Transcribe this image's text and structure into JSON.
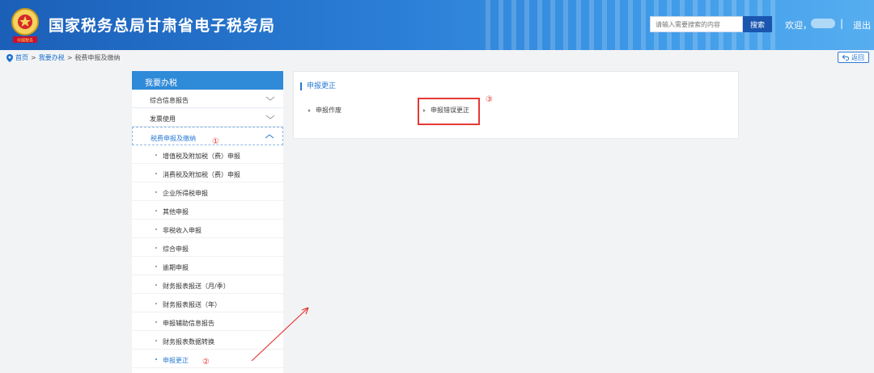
{
  "header": {
    "site_title": "国家税务总局甘肃省电子税务局",
    "search_placeholder": "请输入需要搜索的内容",
    "search_label": "搜索",
    "welcome": "欢迎，",
    "separator": "|",
    "logout": "退出",
    "emblem_text": "中国税务"
  },
  "breadcrumb": {
    "home": "首页",
    "sep1": ">",
    "level2": "我要办税",
    "sep2": ">",
    "level3": "税费申报及缴纳"
  },
  "back_label": "返回",
  "sidebar": {
    "title": "我要办税",
    "categories": [
      {
        "label": "综合信息报告"
      },
      {
        "label": "发票使用"
      },
      {
        "label": "税费申报及缴纳"
      }
    ],
    "sub_items": [
      {
        "label": "增值税及附加税（费）申报"
      },
      {
        "label": "消费税及附加税（费）申报"
      },
      {
        "label": "企业所得税申报"
      },
      {
        "label": "其他申报"
      },
      {
        "label": "非税收入申报"
      },
      {
        "label": "综合申报"
      },
      {
        "label": "逾期申报"
      },
      {
        "label": "财务报表报送（月/季）"
      },
      {
        "label": "财务报表报送（年）"
      },
      {
        "label": "申报辅助信息报告"
      },
      {
        "label": "财务报表数据转换"
      },
      {
        "label": "申报更正"
      }
    ]
  },
  "content": {
    "section_title": "申报更正",
    "items": [
      {
        "label": "申报作废"
      },
      {
        "label": "申报错误更正"
      }
    ]
  },
  "annotations": {
    "mark1": "①",
    "mark2": "②",
    "mark3": "③",
    "color": "#e53935"
  },
  "colors": {
    "accent": "#2a7ad4",
    "header": "#2b7ed6",
    "sidebar_head": "#2f8ad8"
  }
}
